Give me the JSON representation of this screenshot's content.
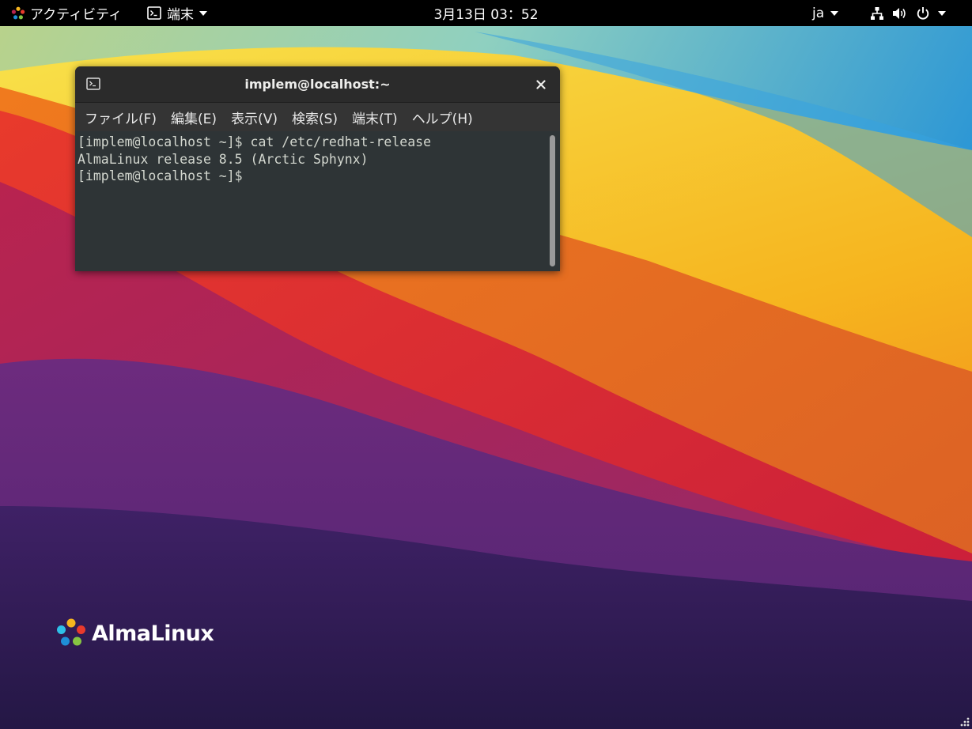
{
  "topbar": {
    "activities_label": "アクティビティ",
    "app_menu_label": "端末",
    "clock": "3月13日 03：52",
    "language": "ja"
  },
  "terminal": {
    "title": "implem@localhost:~",
    "menu": [
      "ファイル(F)",
      "編集(E)",
      "表示(V)",
      "検索(S)",
      "端末(T)",
      "ヘルプ(H)"
    ],
    "lines": [
      "[implem@localhost ~]$ cat /etc/redhat-release",
      "AlmaLinux release 8.5 (Arctic Sphynx)",
      "[implem@localhost ~]$ "
    ],
    "colors": {
      "background": "#2e3436",
      "text": "#d3d7cf",
      "titlebar": "#2b2b2b"
    }
  },
  "desktop": {
    "logo_text": "AlmaLinux"
  },
  "icons": {
    "distro": "almalinux-logo-icon",
    "app": "terminal-icon",
    "network": "network-icon",
    "volume": "volume-icon",
    "power": "power-icon",
    "close": "close-icon"
  }
}
